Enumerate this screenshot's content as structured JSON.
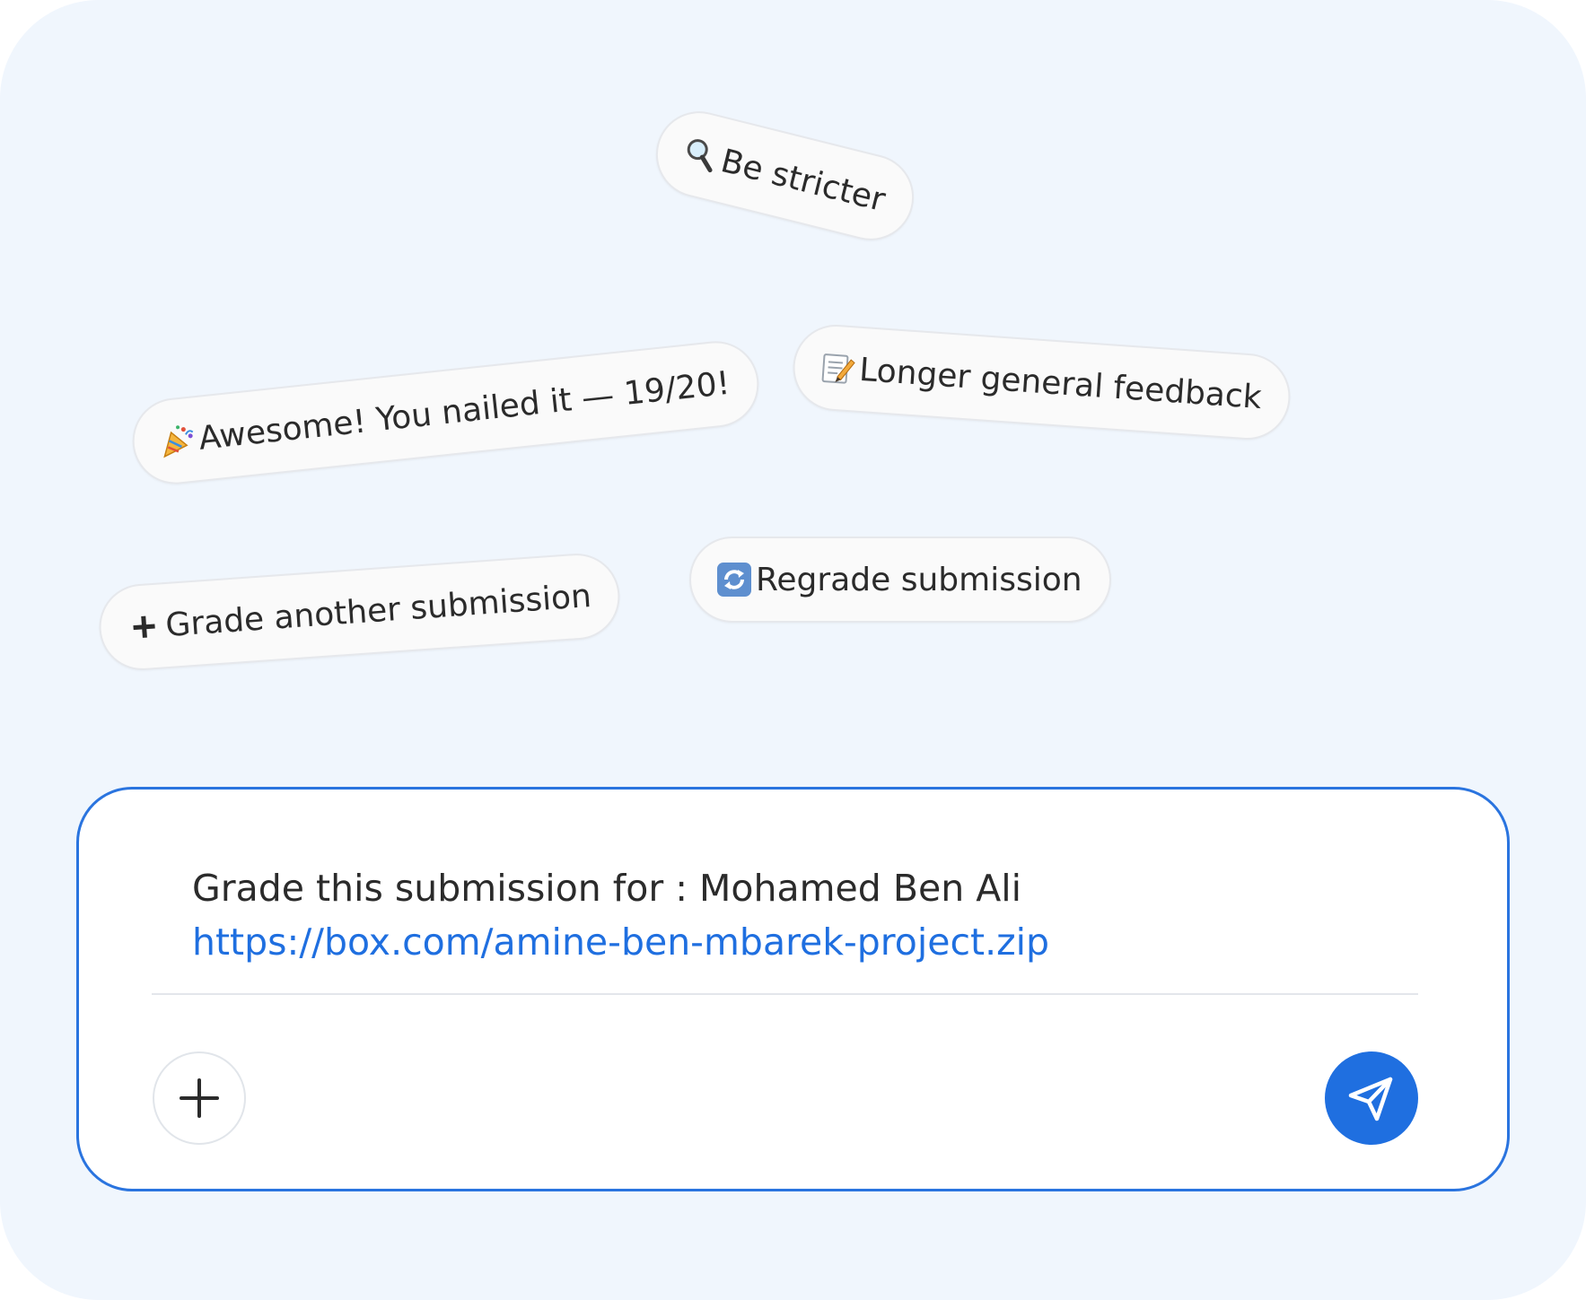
{
  "colors": {
    "background": "#f0f6fd",
    "chip_background": "#fafafa",
    "chip_border": "#e6e8ec",
    "composer_border": "#2a74df",
    "link": "#1f6fe0",
    "send_button": "#1f6fe0",
    "text": "#2b2b2b"
  },
  "suggestions": [
    {
      "icon": "magnifying-glass-icon",
      "label": "Be stricter"
    },
    {
      "icon": "memo-pencil-icon",
      "label": "Longer general feedback"
    },
    {
      "icon": "party-popper-icon",
      "label": "Awesome! You nailed it — 19/20!"
    },
    {
      "icon": "refresh-arrows-icon",
      "label": "Regrade submission"
    },
    {
      "icon": "plus-icon",
      "label": "Grade another submission"
    }
  ],
  "composer": {
    "message_line": "Grade this submission for : Mohamed Ben Ali",
    "message_link": "https://box.com/amine-ben-mbarek-project.zip",
    "attach_icon": "plus-icon",
    "send_icon": "paper-plane-icon"
  }
}
